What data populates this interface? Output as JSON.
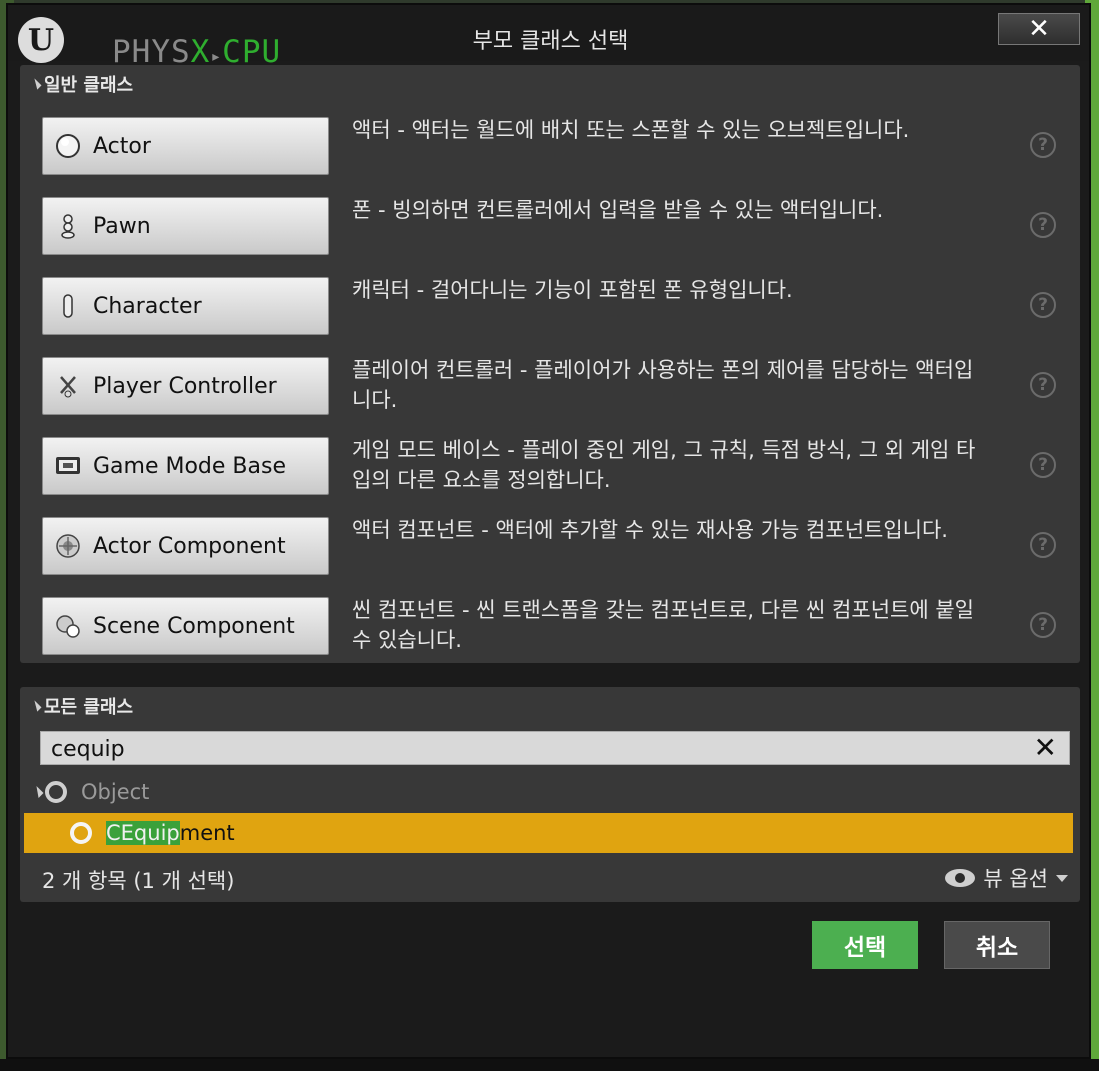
{
  "window": {
    "title": "부모 클래스 선택",
    "close_glyph": "✕",
    "physx_overlay": {
      "part1": "PHYS",
      "part2": "X",
      "part3": "▸",
      "part4": "CPU"
    }
  },
  "common_classes": {
    "header": "일반 클래스",
    "items": [
      {
        "label": "Actor",
        "icon": "actor-sphere-icon",
        "description": "액터 - 액터는 월드에 배치 또는 스폰할 수 있는 오브젝트입니다."
      },
      {
        "label": "Pawn",
        "icon": "pawn-icon",
        "description": "폰 - 빙의하면 컨트롤러에서 입력을 받을 수 있는 액터입니다."
      },
      {
        "label": "Character",
        "icon": "character-icon",
        "description": "캐릭터 - 걸어다니는 기능이 포함된 폰 유형입니다."
      },
      {
        "label": "Player Controller",
        "icon": "player-controller-icon",
        "description": "플레이어 컨트롤러 - 플레이어가 사용하는 폰의 제어를 담당하는 액터입니다."
      },
      {
        "label": "Game Mode Base",
        "icon": "game-mode-icon",
        "description": "게임 모드 베이스 - 플레이 중인 게임, 그 규칙, 득점 방식, 그 외 게임 타입의 다른 요소를 정의합니다."
      },
      {
        "label": "Actor Component",
        "icon": "actor-component-icon",
        "description": "액터 컴포넌트 - 액터에 추가할 수 있는 재사용 가능 컴포넌트입니다."
      },
      {
        "label": "Scene Component",
        "icon": "scene-component-icon",
        "description": "씬 컴포넌트 - 씬 트랜스폼을 갖는 컴포넌트로, 다른 씬 컴포넌트에 붙일 수 있습니다."
      }
    ],
    "help_glyph": "?"
  },
  "all_classes": {
    "header": "모든 클래스",
    "search": {
      "value": "cequip",
      "clear_glyph": "✕"
    },
    "tree": {
      "root": "Object",
      "selected": {
        "match": "CEquip",
        "rest": "ment"
      }
    },
    "status": "2 개 항목 (1 개 선택)",
    "view_options": "뷰 옵션"
  },
  "buttons": {
    "select": "선택",
    "cancel": "취소"
  },
  "colors": {
    "select_green": "#4caf50",
    "selected_row": "#e0a410",
    "highlight_match": "#3aa13a"
  }
}
